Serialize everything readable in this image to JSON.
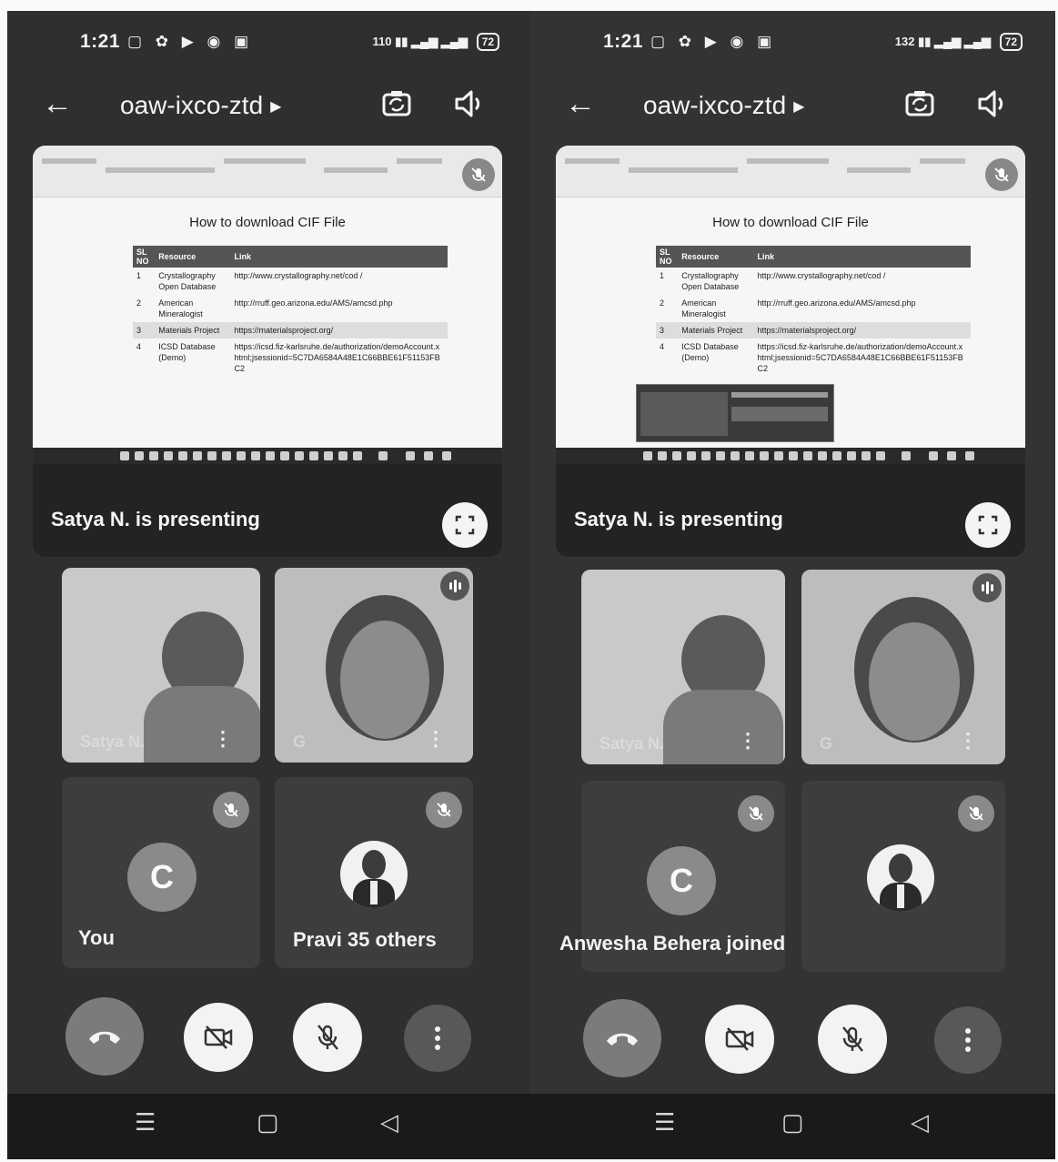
{
  "phones": [
    {
      "status": {
        "time": "1:21",
        "net_speed": "110",
        "battery": "72"
      },
      "header": {
        "meeting_code": "oaw-ixco-ztd"
      },
      "presentation": {
        "slide_title": "How to download CIF File",
        "table_headers": [
          "SL NO",
          "Resource",
          "Link"
        ],
        "rows": [
          [
            "1",
            "Crystallography Open Database",
            "http://www.crystallography.net/cod /"
          ],
          [
            "2",
            "American Mineralogist",
            "http://rruff.geo.arizona.edu/AMS/amcsd.php"
          ],
          [
            "3",
            "Materials Project",
            "https://materialsproject.org/"
          ],
          [
            "4",
            "ICSD Database (Demo)",
            "https://icsd.fiz-karlsruhe.de/authorization/demoAccount.xhtml;jsessionid=5C7DA6584A48E1C66BBE61F51153FBC2"
          ]
        ],
        "presenting_label": "Satya N. is presenting"
      },
      "tiles": {
        "video1_name": "Satya N.",
        "video2_name": "G",
        "self_avatar": "C",
        "self_label": "You"
      },
      "bottom_label": "Pravi 35 others"
    },
    {
      "status": {
        "time": "1:21",
        "net_speed": "132",
        "battery": "72"
      },
      "header": {
        "meeting_code": "oaw-ixco-ztd"
      },
      "presentation": {
        "slide_title": "How to download CIF File",
        "table_headers": [
          "SL NO",
          "Resource",
          "Link"
        ],
        "rows": [
          [
            "1",
            "Crystallography Open Database",
            "http://www.crystallography.net/cod /"
          ],
          [
            "2",
            "American Mineralogist",
            "http://rruff.geo.arizona.edu/AMS/amcsd.php"
          ],
          [
            "3",
            "Materials Project",
            "https://materialsproject.org/"
          ],
          [
            "4",
            "ICSD Database (Demo)",
            "https://icsd.fiz-karlsruhe.de/authorization/demoAccount.xhtml;jsessionid=5C7DA6584A48E1C66BBE61F51153FBC2"
          ]
        ],
        "presenting_label": "Satya N. is presenting"
      },
      "tiles": {
        "video1_name": "Satya N.",
        "video2_name": "G",
        "self_avatar": "C"
      },
      "bottom_label": "Anwesha Behera joined"
    }
  ]
}
